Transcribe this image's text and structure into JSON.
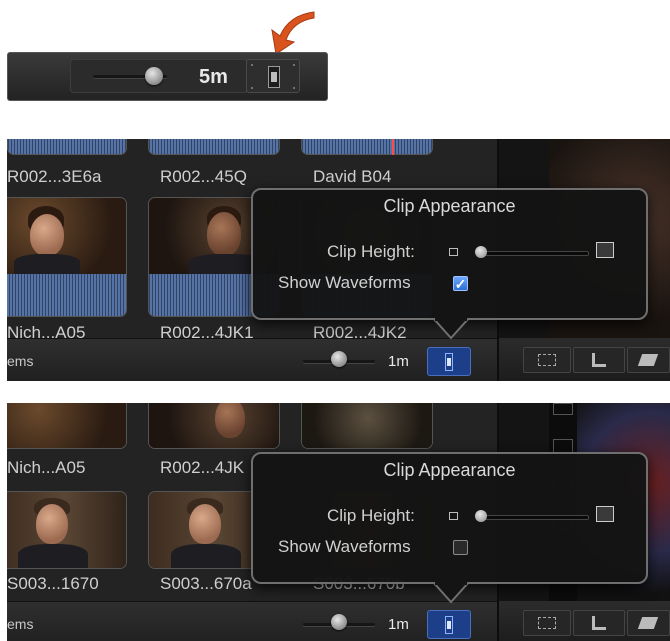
{
  "colors": {
    "accent_arrow": "#d9531f",
    "waveform_blue": "#5673a6",
    "checkbox_blue": "#2b6fd6",
    "playhead": "#ff4a4a"
  },
  "top_toolbar": {
    "zoom_label": "5m",
    "appearance_button_icon": "clip-appearance-icon"
  },
  "panel1": {
    "top_row_labels": [
      "R002...3E6a",
      "R002...45Q",
      "David B04"
    ],
    "clip_labels": [
      "Nich...A05",
      "R002...4JK1",
      "R002...4JK2"
    ],
    "items_label": "ems",
    "zoom_label": "1m",
    "popover": {
      "title": "Clip Appearance",
      "clip_height_label": "Clip Height:",
      "show_waveforms_label": "Show Waveforms",
      "show_waveforms_checked": true
    }
  },
  "panel2": {
    "top_row_labels": [
      "Nich...A05",
      "R002...4JK"
    ],
    "clip_labels": [
      "S003...1670",
      "S003...670a",
      "S003...670b"
    ],
    "items_label": "ems",
    "zoom_label": "1m",
    "popover": {
      "title": "Clip Appearance",
      "clip_height_label": "Clip Height:",
      "show_waveforms_label": "Show Waveforms",
      "show_waveforms_checked": false
    }
  }
}
